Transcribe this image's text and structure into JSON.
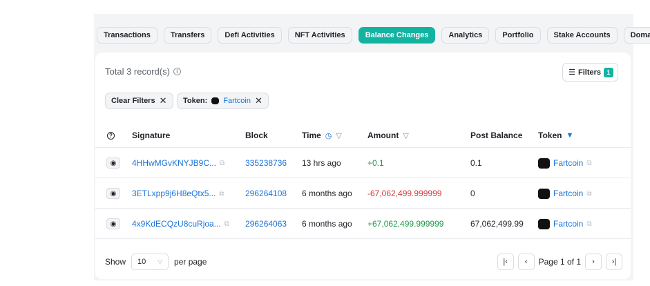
{
  "tabs": [
    {
      "label": "Transactions",
      "active": false
    },
    {
      "label": "Transfers",
      "active": false
    },
    {
      "label": "Defi Activities",
      "active": false
    },
    {
      "label": "NFT Activities",
      "active": false
    },
    {
      "label": "Balance Changes",
      "active": true
    },
    {
      "label": "Analytics",
      "active": false
    },
    {
      "label": "Portfolio",
      "active": false
    },
    {
      "label": "Stake Accounts",
      "active": false
    },
    {
      "label": "Domains",
      "active": false
    }
  ],
  "summary": {
    "total_label": "Total 3 record(s)"
  },
  "filters": {
    "label": "Filters",
    "count": "1"
  },
  "chips": {
    "clear_label": "Clear Filters",
    "token_prefix": "Token:",
    "token_value": "Fartcoin"
  },
  "columns": {
    "signature": "Signature",
    "block": "Block",
    "time": "Time",
    "amount": "Amount",
    "post_balance": "Post Balance",
    "token": "Token"
  },
  "rows": [
    {
      "signature": "4HHwMGvKNYJB9C...",
      "block": "335238736",
      "time": "13 hrs ago",
      "amount": "+0.1",
      "post_balance": "0.1",
      "token": "Fartcoin"
    },
    {
      "signature": "3ETLxpp9j6H8eQtx5...",
      "block": "296264108",
      "time": "6 months ago",
      "amount": "-67,062,499.999999",
      "post_balance": "0",
      "token": "Fartcoin"
    },
    {
      "signature": "4x9KdECQzU8cuRjoa...",
      "block": "296264063",
      "time": "6 months ago",
      "amount": "+67,062,499.999999",
      "post_balance": "67,062,499.99",
      "token": "Fartcoin"
    }
  ],
  "pagination": {
    "show_label": "Show",
    "page_size": "10",
    "per_page_label": "per page",
    "page_label": "Page 1 of 1"
  },
  "colors": {
    "accent": "#13b3a1",
    "link": "#1a73d9",
    "positive": "#1f9a4a",
    "negative": "#d9373b"
  }
}
